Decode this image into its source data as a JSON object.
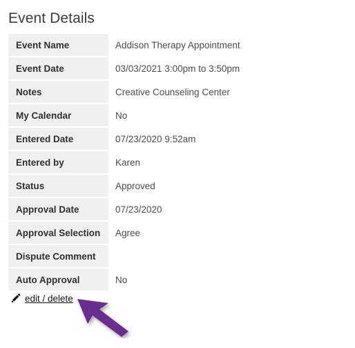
{
  "page": {
    "title": "Event Details"
  },
  "details": {
    "rows": [
      {
        "label": "Event Name",
        "value": "Addison Therapy Appointment"
      },
      {
        "label": "Event Date",
        "value": "03/03/2021 3:00pm to 3:50pm"
      },
      {
        "label": "Notes",
        "value": "Creative Counseling Center"
      },
      {
        "label": "My Calendar",
        "value": "No"
      },
      {
        "label": "Entered Date",
        "value": "07/23/2020 9:52am"
      },
      {
        "label": "Entered by",
        "value": "Karen"
      },
      {
        "label": "Status",
        "value": "Approved"
      },
      {
        "label": "Approval Date",
        "value": "07/23/2020"
      },
      {
        "label": "Approval Selection",
        "value": "Agree"
      },
      {
        "label": "Dispute Comment",
        "value": ""
      },
      {
        "label": "Auto Approval",
        "value": "No"
      }
    ]
  },
  "actions": {
    "edit_delete_label": "edit / delete",
    "edit_icon": "pencil-icon"
  },
  "annotation": {
    "arrow_icon": "arrow-pointer",
    "arrow_color": "#6b2d8e"
  },
  "colors": {
    "label_cell_bg": "#f0f0f0",
    "label_text": "#2f2f2f",
    "value_text": "#4a4a4a",
    "title_text": "#3b3b3b",
    "link_text": "#121212",
    "page_bg": "#ffffff"
  }
}
